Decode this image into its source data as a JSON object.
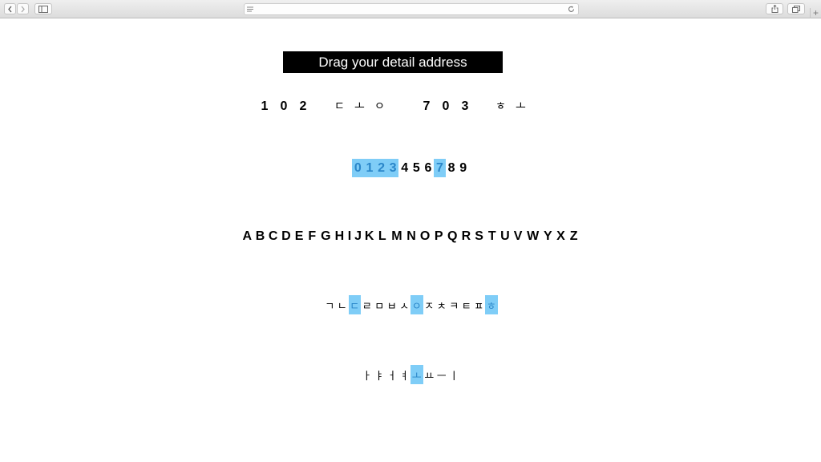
{
  "browser": {
    "icons": [
      "back-icon",
      "forward-icon",
      "sidebar-icon",
      "reader-lines-icon",
      "reload-icon",
      "share-icon",
      "tabs-icon",
      "new-tab-icon"
    ],
    "new_tab_symbol": "+"
  },
  "title": "Drag your detail address",
  "address": {
    "building_number": [
      "1",
      "0",
      "2"
    ],
    "building_unit": [
      "ㄷ",
      "ㅗ",
      "ㅇ"
    ],
    "room_number": [
      "7",
      "0",
      "3"
    ],
    "room_unit": [
      "ㅎ",
      "ㅗ"
    ]
  },
  "digits": {
    "chars": [
      "0",
      "1",
      "2",
      "3",
      "4",
      "5",
      "6",
      "7",
      "8",
      "9"
    ],
    "selected": [
      0,
      1,
      2,
      3,
      7
    ]
  },
  "alphabet": {
    "chars": [
      "A",
      "B",
      "C",
      "D",
      "E",
      "F",
      "G",
      "H",
      "I",
      "J",
      "K",
      "L",
      "M",
      "N",
      "O",
      "P",
      "Q",
      "R",
      "S",
      "T",
      "U",
      "V",
      "W",
      "Y",
      "X",
      "Z"
    ],
    "selected": []
  },
  "consonants": {
    "chars": [
      "ㄱ",
      "ㄴ",
      "ㄷ",
      "ㄹ",
      "ㅁ",
      "ㅂ",
      "ㅅ",
      "ㅇ",
      "ㅈ",
      "ㅊ",
      "ㅋ",
      "ㅌ",
      "ㅍ",
      "ㅎ"
    ],
    "selected": [
      2,
      7,
      13
    ]
  },
  "vowels": {
    "chars": [
      "ㅏ",
      "ㅑ",
      "ㅓ",
      "ㅕ",
      "ㅗ",
      "ㅛ",
      "ㅡ",
      "ㅣ"
    ],
    "selected": [
      4
    ]
  },
  "colors": {
    "selection_bg": "#7fcdf7",
    "selection_text": "#2a86c9",
    "title_bg": "#000000",
    "title_text": "#ffffff"
  }
}
